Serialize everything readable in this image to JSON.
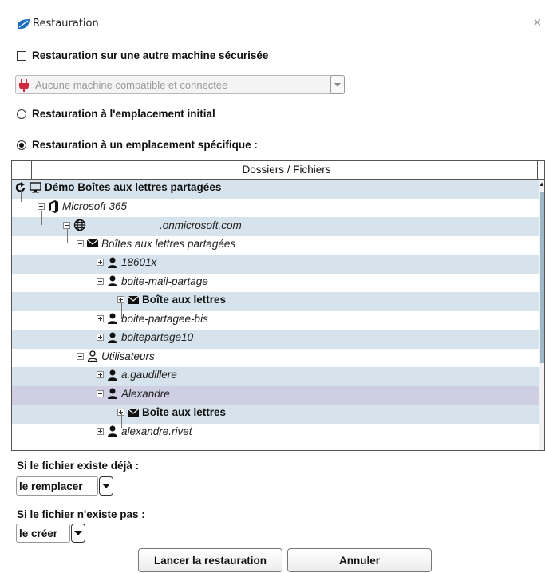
{
  "window": {
    "title": "Restauration",
    "close_symbol": "×"
  },
  "options": {
    "other_machine_label": "Restauration sur une autre machine sécurisée",
    "machine_select_value": "Aucune machine compatible et connectée",
    "initial_location_label": "Restauration à l'emplacement initial",
    "specific_location_label": "Restauration à un emplacement spécifique :"
  },
  "tree": {
    "header": "Dossiers / Fichiers",
    "rows": [
      {
        "label": "Démo Boîtes aux lettres partagées"
      },
      {
        "label": "Microsoft 365"
      },
      {
        "label": ".onmicrosoft.com"
      },
      {
        "label": "Boîtes aux lettres partagées"
      },
      {
        "label": "18601x"
      },
      {
        "label": "boite-mail-partage"
      },
      {
        "label": "Boîte aux lettres"
      },
      {
        "label": "boite-partagee-bis"
      },
      {
        "label": "boitepartage10"
      },
      {
        "label": "Utilisateurs"
      },
      {
        "label": "a.gaudillere"
      },
      {
        "label": "Alexandre"
      },
      {
        "label": "Boîte aux lettres"
      },
      {
        "label": "alexandre.rivet"
      }
    ]
  },
  "if_exists": {
    "label": "Si le fichier existe déjà :",
    "value": "le remplacer"
  },
  "if_not_exists": {
    "label": "Si le fichier n'existe pas :",
    "value": "le créer"
  },
  "buttons": {
    "start": "Lancer la restauration",
    "cancel": "Annuler"
  },
  "colors": {
    "row_alt": "#d6e3ec",
    "row_selected": "#cfcee3",
    "app_icon": "#1f6fc0",
    "plug_icon": "#d12a3a"
  }
}
